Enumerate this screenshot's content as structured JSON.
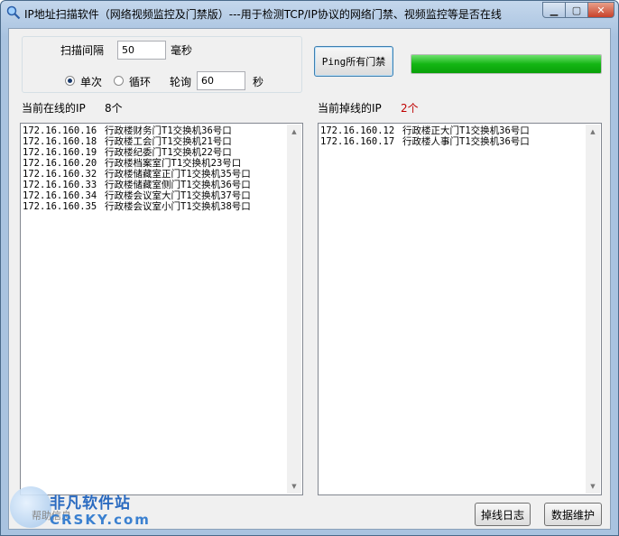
{
  "window": {
    "title": "IP地址扫描软件（网络视频监控及门禁版）---用于检测TCP/IP协议的网络门禁、视频监控等是否在线"
  },
  "controls": {
    "scan_interval_label": "扫描间隔",
    "scan_interval_value": "50",
    "scan_interval_unit": "毫秒",
    "mode_single_label": "单次",
    "mode_loop_label": "循环",
    "mode_selected": "单次",
    "poll_label": "轮询",
    "poll_value": "60",
    "poll_unit": "秒",
    "ping_button_label": "Ping所有门禁",
    "progress_fraction": 1.0,
    "progress_color": "#14b614"
  },
  "online": {
    "label": "当前在线的IP",
    "count": "8个",
    "items": [
      {
        "ip": "172.16.160.16",
        "desc": "行政楼财务门T1交换机36号口"
      },
      {
        "ip": "172.16.160.18",
        "desc": "行政楼工会门T1交换机21号口"
      },
      {
        "ip": "172.16.160.19",
        "desc": "行政楼纪委门T1交换机22号口"
      },
      {
        "ip": "172.16.160.20",
        "desc": "行政楼档案室门T1交换机23号口"
      },
      {
        "ip": "172.16.160.32",
        "desc": "行政楼储藏室正门T1交换机35号口"
      },
      {
        "ip": "172.16.160.33",
        "desc": "行政楼储藏室侧门T1交换机36号口"
      },
      {
        "ip": "172.16.160.34",
        "desc": "行政楼会议室大门T1交换机37号口"
      },
      {
        "ip": "172.16.160.35",
        "desc": "行政楼会议室小门T1交换机38号口"
      }
    ]
  },
  "offline": {
    "label": "当前掉线的IP",
    "count": "2个",
    "count_color": "#c00000",
    "items": [
      {
        "ip": "172.16.160.12",
        "desc": "行政楼正大门T1交换机36号口"
      },
      {
        "ip": "172.16.160.17",
        "desc": "行政楼人事门T1交换机36号口"
      }
    ]
  },
  "footer": {
    "log_button_label": "掉线日志",
    "maintain_button_label": "数据维护"
  },
  "watermark": {
    "title": "非凡软件站",
    "subtitle": "CRSKY.com",
    "help_text": "帮助信息"
  }
}
